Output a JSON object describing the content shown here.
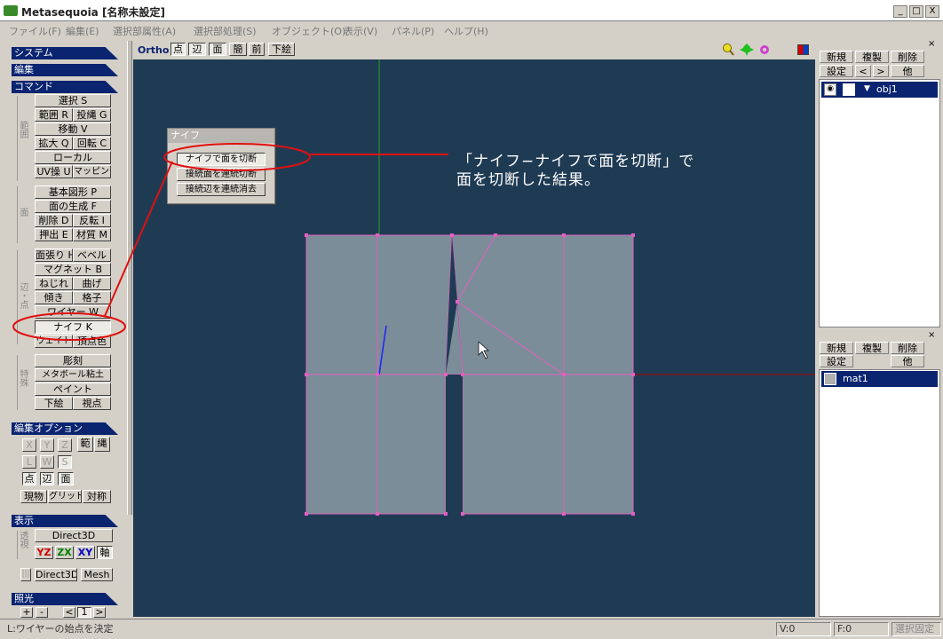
{
  "window": {
    "title": "Metasequoia [名称未設定]",
    "buttons": [
      "_",
      "□",
      "X"
    ]
  },
  "menu": [
    "ファイル(F)",
    "編集(E)",
    "選択部属性(A)",
    "選択部処理(S)",
    "オブジェクト(O)",
    "表示(V)",
    "パネル(P)",
    "ヘルプ(H)"
  ],
  "left": {
    "system": "システム",
    "edit": "編集",
    "command": "コマンド",
    "group_range": "範\n囲",
    "group_face": "面",
    "group_edge": "辺・点",
    "group_special": "特殊",
    "cmd": {
      "select": "選択 S",
      "range": "範囲 R",
      "lasso": "投縄 G",
      "move": "移動 V",
      "scale": "拡大 Q",
      "rotate": "回転 C",
      "local": "ローカル",
      "uv": "UV操 U",
      "mapping": "マッピング",
      "basic": "基本図形 P",
      "facegen": "面の生成 F",
      "delete": "削除 D",
      "flip": "反転 I",
      "extrude": "押出 E",
      "material": "材質 M",
      "stretch": "面張り H",
      "bevel": "ベベル",
      "magnet": "マグネット B",
      "twist": "ねじれ",
      "bend": "曲げ",
      "tilt": "傾き",
      "lattice": "格子",
      "wire": "ワイヤー W",
      "knife": "ナイフ K",
      "weight": "ウェイト",
      "vcolor": "頂点色",
      "sculpt": "彫刻",
      "metaball": "メタボール粘土",
      "paint": "ペイント",
      "underlay": "下絵",
      "viewpoint": "視点"
    },
    "editopt": "編集オプション",
    "opt": {
      "x": "X",
      "y": "Y",
      "z": "Z",
      "range": "範",
      "lasso": "縄",
      "l": "L",
      "w": "W",
      "s": "S",
      "point": "点",
      "edge": "辺",
      "face": "面",
      "current": "現物",
      "grid": "グリッド",
      "symm": "対称"
    },
    "display": "表示",
    "group_persp": "透視",
    "disp": {
      "d3d": "Direct3D",
      "yz": "YZ",
      "zx": "ZX",
      "xy": "XY",
      "axis": "軸",
      "d3d2": "Direct3D",
      "mesh": "Mesh"
    },
    "lighting": "照光",
    "light": {
      "plus": "+",
      "minus": "-",
      "prev": "<",
      "num": "1",
      "next": ">"
    }
  },
  "viewbar": {
    "ortho": "Ortho",
    "point": "点",
    "edge": "辺",
    "face": "面",
    "simple": "簡",
    "front": "前",
    "underlay": "下絵"
  },
  "knife_popup": {
    "title": "ナイフ",
    "b1": "ナイフで面を切断",
    "b2": "接続面を連続切断",
    "b3": "接続辺を連続消去"
  },
  "annotation": {
    "line1": "「ナイフ−ナイフで面を切断」で",
    "line2": "面を切断した結果。"
  },
  "objects": {
    "new": "新規",
    "dup": "複製",
    "del": "削除",
    "settings": "設定",
    "prev": "<",
    "next": ">",
    "other": "他",
    "item": "obj1"
  },
  "materials": {
    "new": "新規",
    "dup": "複製",
    "del": "削除",
    "settings": "設定",
    "other": "他",
    "item": "mat1"
  },
  "status": {
    "message": "L:ワイヤーの始点を決定",
    "v": "V:0",
    "f": "F:0",
    "lock": "選択固定"
  }
}
